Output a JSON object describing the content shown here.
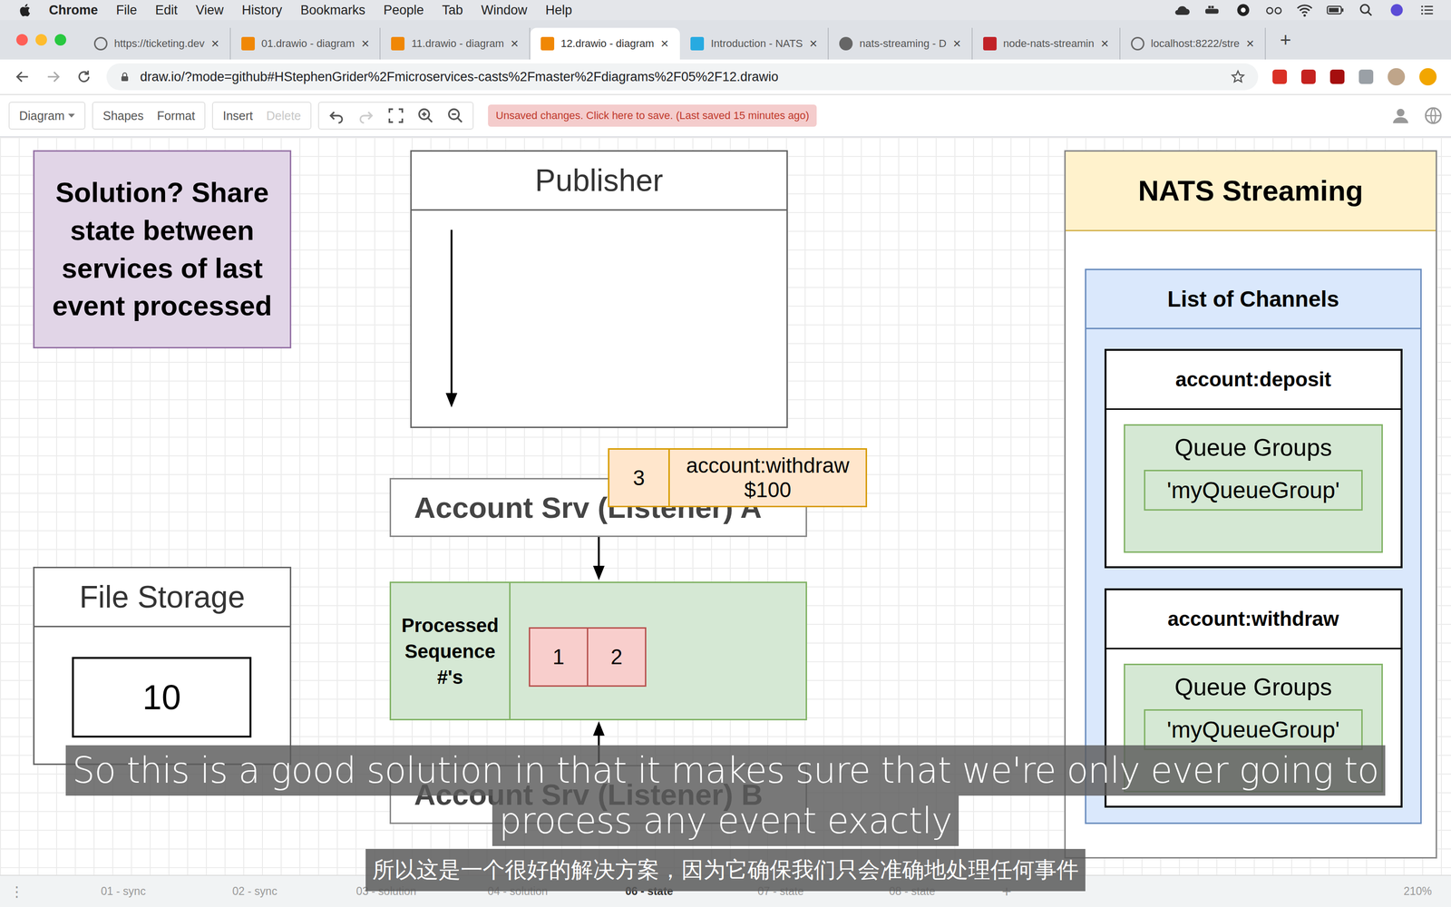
{
  "menu_bar": {
    "app": "Chrome",
    "items": [
      "File",
      "Edit",
      "View",
      "History",
      "Bookmarks",
      "People",
      "Tab",
      "Window",
      "Help"
    ]
  },
  "tabs": [
    {
      "label": "https://ticketing.dev",
      "kind": "site",
      "selected": false
    },
    {
      "label": "01.drawio - diagram",
      "kind": "drawio",
      "selected": false
    },
    {
      "label": "11.drawio - diagram",
      "kind": "drawio",
      "selected": false
    },
    {
      "label": "12.drawio - diagram",
      "kind": "drawio",
      "selected": true
    },
    {
      "label": "Introduction - NATS",
      "kind": "nats",
      "selected": false
    },
    {
      "label": "nats-streaming - D",
      "kind": "docker",
      "selected": false
    },
    {
      "label": "node-nats-streamin",
      "kind": "npm",
      "selected": false
    },
    {
      "label": "localhost:8222/stre",
      "kind": "site",
      "selected": false
    }
  ],
  "tab_close": "×",
  "new_tab": "+",
  "address_bar": {
    "url": "draw.io/?mode=github#HStephenGrider%2Fmicroservices-casts%2Fmaster%2Fdiagrams%2F05%2F12.drawio"
  },
  "toolbar": {
    "groups": [
      [
        {
          "label": "Diagram",
          "disabled": false,
          "dropdown": true
        }
      ],
      [
        {
          "label": "Shapes",
          "disabled": false,
          "dropdown": false
        },
        {
          "label": "Format",
          "disabled": false,
          "dropdown": false
        }
      ],
      [
        {
          "label": "Insert",
          "disabled": false,
          "dropdown": false
        },
        {
          "label": "Delete",
          "disabled": true,
          "dropdown": false
        }
      ]
    ],
    "icon_buttons": [
      {
        "kind": "undo",
        "disabled": false
      },
      {
        "kind": "redo",
        "disabled": true
      },
      {
        "kind": "fit",
        "disabled": false
      },
      {
        "kind": "zoom-in",
        "disabled": false
      },
      {
        "kind": "zoom-out",
        "disabled": false
      }
    ],
    "notice": "Unsaved changes. Click here to save. (Last saved 15 minutes ago)"
  },
  "canvas": {
    "note": {
      "lines": [
        "Solution?  Share",
        "state between",
        "services of last",
        "event processed"
      ]
    },
    "publisher": {
      "title": "Publisher"
    },
    "listener_a": {
      "title": "Account Srv (Listener) A"
    },
    "event": {
      "sequence": "3",
      "name": "account:withdraw",
      "amount": "$100"
    },
    "processed": {
      "label": "Processed Sequence #'s",
      "sequences": [
        "1",
        "2"
      ]
    },
    "listener_b": {
      "title": "Account Srv (Listener) B"
    },
    "file_storage": {
      "title": "File Storage",
      "value": "10"
    },
    "nats": {
      "title": "NATS Streaming",
      "list_title": "List of Channels",
      "channels": [
        {
          "name": "account:deposit",
          "groups_title": "Queue Groups",
          "groups": [
            "'myQueueGroup'"
          ]
        },
        {
          "name": "account:withdraw",
          "groups_title": "Queue Groups",
          "groups": [
            "'myQueueGroup'"
          ]
        }
      ]
    }
  },
  "pages": {
    "menu": "⋮",
    "items": [
      {
        "label": "01 - sync",
        "selected": false
      },
      {
        "label": "02 - sync",
        "selected": false
      },
      {
        "label": "03 - solution",
        "selected": false
      },
      {
        "label": "04 - solution",
        "selected": false
      },
      {
        "label": "06 - state",
        "selected": true
      },
      {
        "label": "07 - state",
        "selected": false
      },
      {
        "label": "08 - state",
        "selected": false
      }
    ],
    "add": "+",
    "zoom": "210%"
  },
  "subtitles": {
    "english": [
      "So this is a good solution in that it makes sure that we're only ever going to",
      "process any event exactly"
    ],
    "chinese": "所以这是一个很好的解决方案，因为它确保我们只会准确地处理任何事件"
  }
}
